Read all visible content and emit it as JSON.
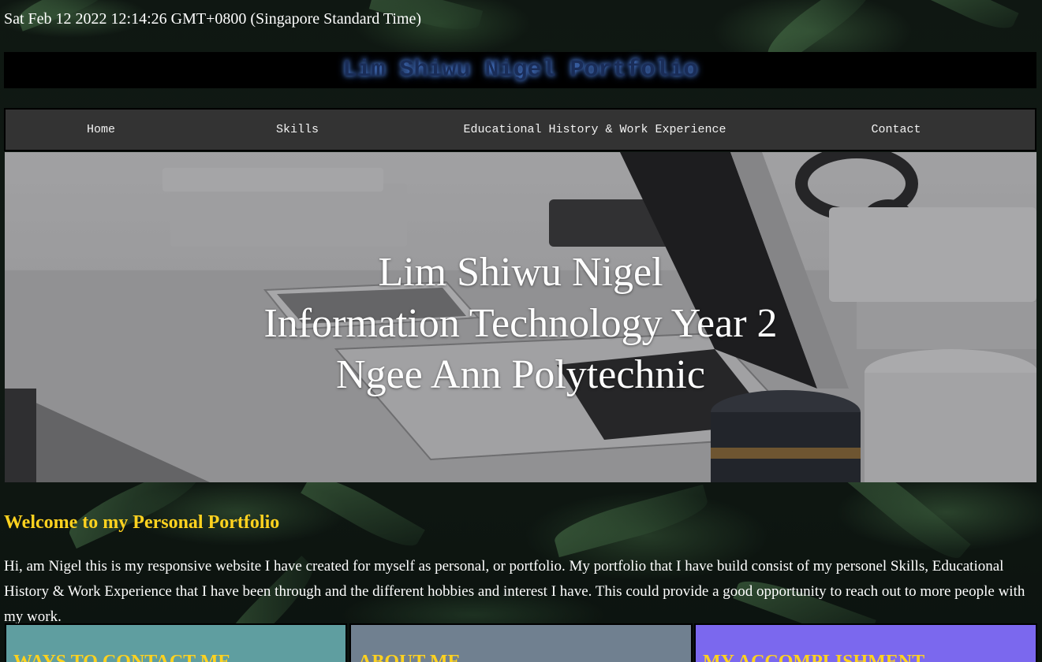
{
  "datetime": "Sat Feb 12 2022 12:14:26 GMT+0800 (Singapore Standard Time)",
  "header": {
    "title": "Lim Shiwu Nigel Portfolio"
  },
  "nav": {
    "items": [
      {
        "label": "Home"
      },
      {
        "label": "Skills"
      },
      {
        "label": "Educational History & Work Experience"
      },
      {
        "label": "Contact"
      }
    ]
  },
  "hero": {
    "line1": "Lim Shiwu Nigel",
    "line2": "Information Technology Year 2",
    "line3": "Ngee Ann Polytechnic"
  },
  "welcome": {
    "title": "Welcome to my Personal Portfolio",
    "body": "Hi, am Nigel this is my responsive website I have created for myself as personal, or portfolio. My portfolio that I have build consist of my personel Skills, Educational History & Work Experience that I have been through and the different hobbies and interest I have. This could provide a good opportunity to reach out to more people with my work."
  },
  "cards": [
    {
      "title": "WAYS TO CONTACT ME",
      "color": "#5f9ea0"
    },
    {
      "title": "ABOUT ME",
      "color": "#708090"
    },
    {
      "title": "MY ACCOMPLISHMENT",
      "color": "#7b68ee"
    }
  ],
  "colors": {
    "accent": "#ffd21f",
    "nav_bg": "#333333",
    "header_bg": "#000000",
    "title_glow": "#4d7fd6"
  }
}
